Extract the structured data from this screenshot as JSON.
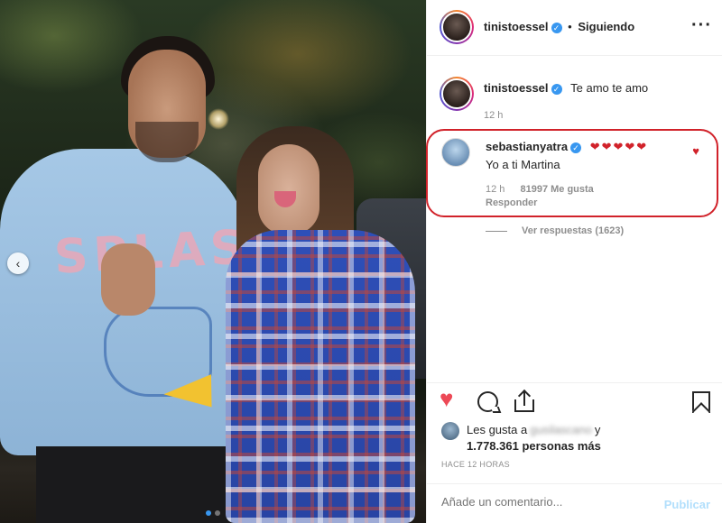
{
  "post": {
    "author": "tinistoessel",
    "follow_status": "Siguiendo",
    "separator": "•",
    "more_icon": "more-horizontal-icon",
    "caption_text": "Te amo te amo",
    "caption_time": "12 h"
  },
  "comment": {
    "author": "sebastianyatra",
    "hearts": "❤❤❤❤❤",
    "text": "Yo a ti Martina",
    "time": "12 h",
    "likes": "81997 Me gusta",
    "reply_label": "Responder"
  },
  "view_replies": "Ver respuestas (1623)",
  "likes": {
    "prefix": "Les gusta a",
    "blurred_user": "gusilascano",
    "suffix": "y",
    "others": "1.778.361 personas más"
  },
  "timestamp": "HACE 12 HORAS",
  "comment_input": {
    "placeholder": "Añade un comentario...",
    "publish_label": "Publicar"
  },
  "colors": {
    "verified": "#3897f0",
    "heart": "#ed4956",
    "highlight_box": "#d1222a",
    "publish_disabled": "#b2dffc"
  },
  "photo": {
    "hoodie_text": "SPLASH",
    "carousel_dots": 2,
    "active_dot": 0
  }
}
